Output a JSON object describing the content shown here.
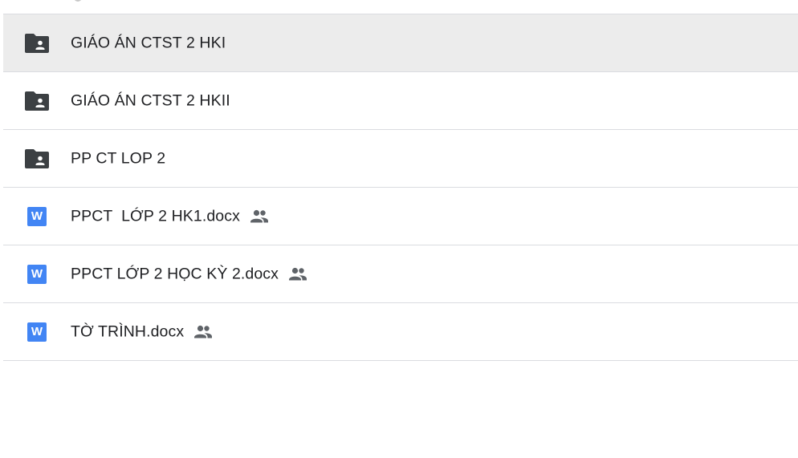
{
  "files": [
    {
      "type": "shared-folder",
      "icon": "shared-folder-icon",
      "name": "GIÁO ÁN CTST 2 HKI",
      "selected": true,
      "shared": false
    },
    {
      "type": "shared-folder",
      "icon": "shared-folder-icon",
      "name": "GIÁO ÁN CTST 2 HKII",
      "selected": false,
      "shared": false
    },
    {
      "type": "shared-folder",
      "icon": "shared-folder-icon",
      "name": "PP CT LOP 2",
      "selected": false,
      "shared": false
    },
    {
      "type": "docx",
      "icon": "word-document-icon",
      "icon_letter": "W",
      "name": "PPCT  LỚP 2 HK1.docx",
      "selected": false,
      "shared": true
    },
    {
      "type": "docx",
      "icon": "word-document-icon",
      "icon_letter": "W",
      "name": "PPCT LỚP 2 HỌC KỲ 2.docx",
      "selected": false,
      "shared": true
    },
    {
      "type": "docx",
      "icon": "word-document-icon",
      "icon_letter": "W",
      "name": "TỜ TRÌNH.docx",
      "selected": false,
      "shared": true
    }
  ],
  "colors": {
    "folder": "#3c4043",
    "word": "#4285f4",
    "selected_row": "#ececec",
    "divider": "#dadce0",
    "text": "#202124"
  },
  "shared_icon": "people-icon"
}
